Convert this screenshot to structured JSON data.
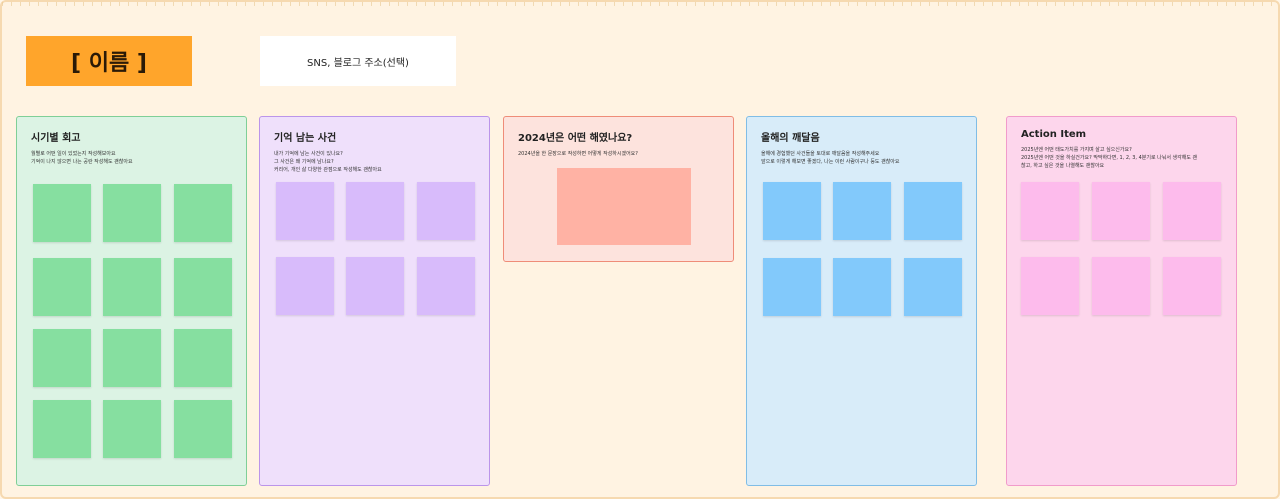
{
  "header": {
    "name_label": "[ 이름 ]",
    "sns_label": "SNS, 블로그 주소(선택)"
  },
  "sections": [
    {
      "title": "시기별 회고",
      "lines": [
        "월별로 어떤 일이 있었는지 작성해보아요",
        "기억이 나지 않으면 나는 공란 작성해도 괜찮아요"
      ],
      "color": "#86dfa0"
    },
    {
      "title": "기억 남는 사건",
      "lines": [
        "내가 기억에 남는 사건이 있나요?",
        "그 사건은 왜 기억에 남나요?",
        "커리어, 개인 삶 다양한 관점으로 작성해도 괜찮아요"
      ],
      "color": "#d8bbfb"
    },
    {
      "title": "2024년은 어떤 해였나요?",
      "lines": [
        "2024년을 한 문장으로 작성하면 어떻게 작성하시겠어요?"
      ],
      "color": "#ffb2a4"
    },
    {
      "title": "올해의 깨달음",
      "lines": [
        "올해에 경험했던 사건들을 토대로 깨달음을 작성해주세요",
        "앞으로 이렇게 해보면 좋겠다, 나는 이런 사람이구나 등도 괜찮아요"
      ],
      "color": "#82c9fb"
    },
    {
      "title": "Action Item",
      "lines": [
        "2025년엔 어떤 태도가치를 가지며 살고 싶으신가요?",
        "2025년엔 어떤 것을 하실건가요? 막막하다면, 1, 2, 3, 4분기로 나눠서 생각해도 괜",
        "찮고, 하고 싶은 것을 나열해도 괜찮아요"
      ],
      "color": "#fdbbec"
    }
  ]
}
